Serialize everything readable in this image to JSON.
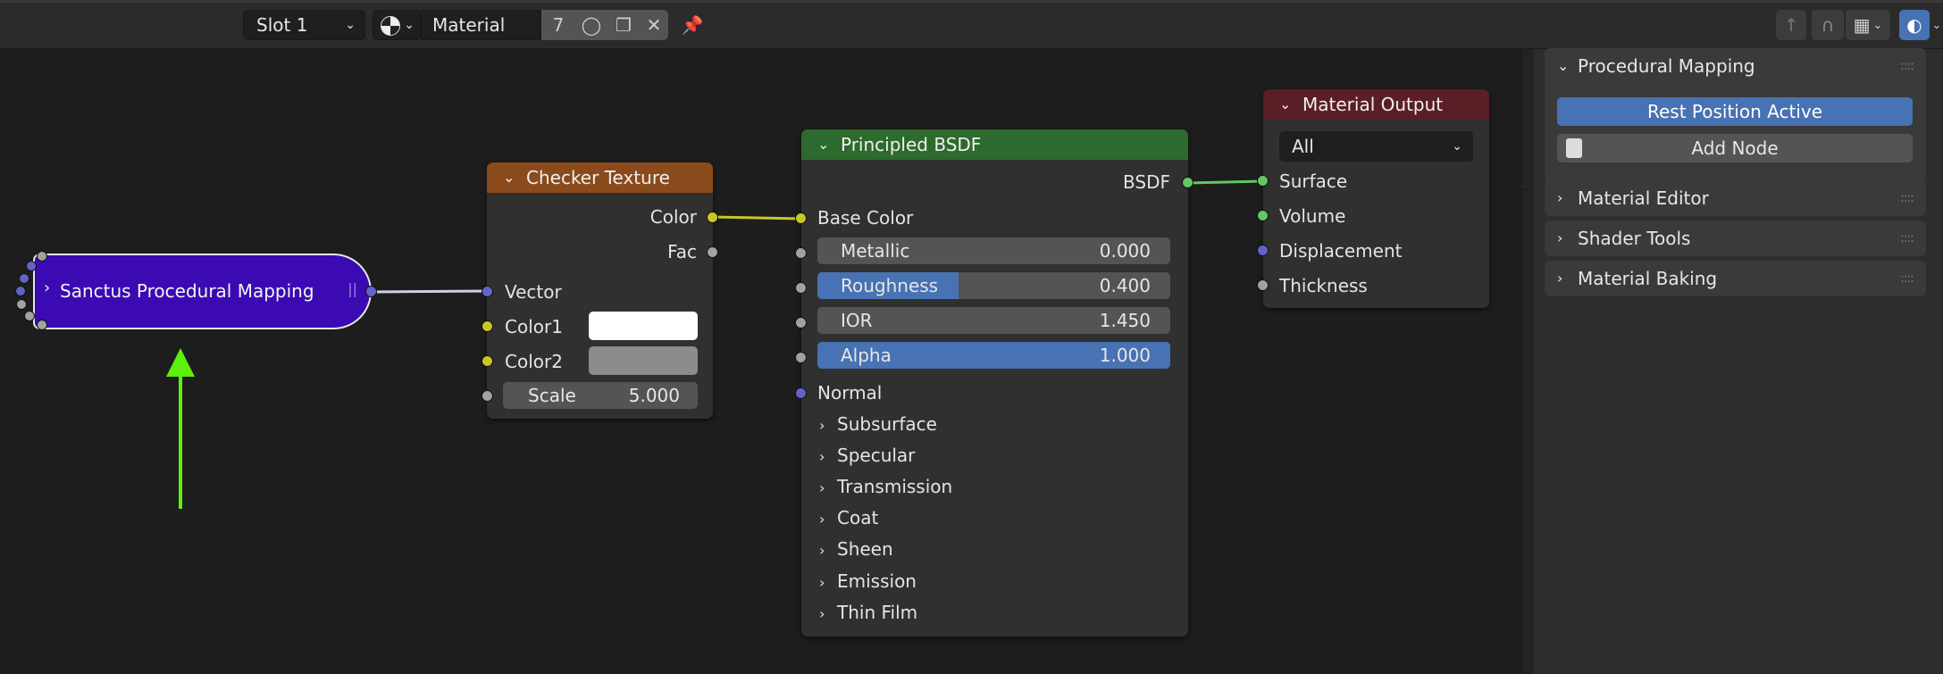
{
  "header": {
    "slot_select": "Slot 1",
    "material_name": "Material",
    "user_count": "7"
  },
  "nodes": {
    "sanctus": {
      "label": "Sanctus Procedural Mapping",
      "color": "#3b0ab3"
    },
    "checker": {
      "title": "Checker Texture",
      "header_color": "#8a4a1c",
      "outputs": [
        "Color",
        "Fac"
      ],
      "inputs": {
        "vector": "Vector",
        "color1": "Color1",
        "color2": "Color2"
      },
      "scale_label": "Scale",
      "scale_value": "5.000"
    },
    "principled": {
      "title": "Principled BSDF",
      "header_color": "#2d6a2d",
      "output": "BSDF",
      "base_color": "Base Color",
      "metallic": {
        "label": "Metallic",
        "value": "0.000"
      },
      "roughness": {
        "label": "Roughness",
        "value": "0.400",
        "fill": 0.4
      },
      "ior": {
        "label": "IOR",
        "value": "1.450"
      },
      "alpha": {
        "label": "Alpha",
        "value": "1.000",
        "fill": 1.0
      },
      "normal": "Normal",
      "panels": [
        "Subsurface",
        "Specular",
        "Transmission",
        "Coat",
        "Sheen",
        "Emission",
        "Thin Film"
      ]
    },
    "output": {
      "title": "Material Output",
      "header_color": "#5a1e26",
      "target": "All",
      "inputs": [
        "Surface",
        "Volume",
        "Displacement",
        "Thickness"
      ]
    }
  },
  "sidebar": {
    "procedural_mapping": "Procedural Mapping",
    "rest_position": "Rest Position Active",
    "add_node": "Add Node",
    "panels": [
      "Material Editor",
      "Shader Tools",
      "Material Baking"
    ]
  },
  "colors": {
    "accent": "#4772b3",
    "arrow": "#5cf00c"
  }
}
